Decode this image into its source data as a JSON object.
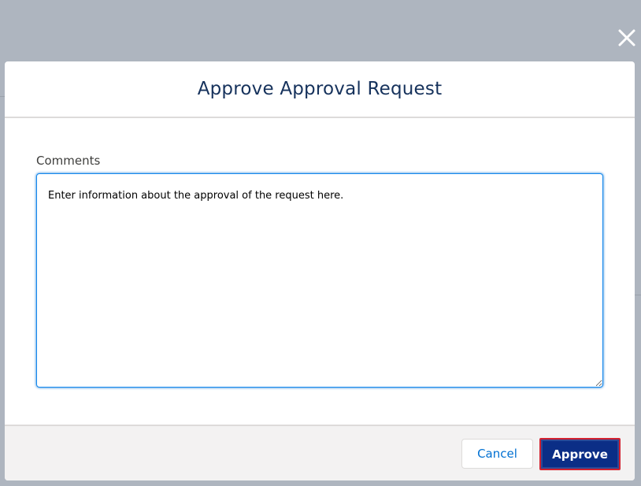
{
  "modal": {
    "title": "Approve Approval Request",
    "comments_label": "Comments",
    "comments_placeholder": "Enter information about the approval of the request here.",
    "comments_value": "",
    "cancel_label": "Cancel",
    "approve_label": "Approve"
  },
  "icons": {
    "close": "close-icon"
  },
  "colors": {
    "overlay": "#aeb5bf",
    "title": "#16325c",
    "approve_bg": "#0b2e86",
    "approve_border": "#d3212f",
    "cancel_text": "#0070d2"
  }
}
